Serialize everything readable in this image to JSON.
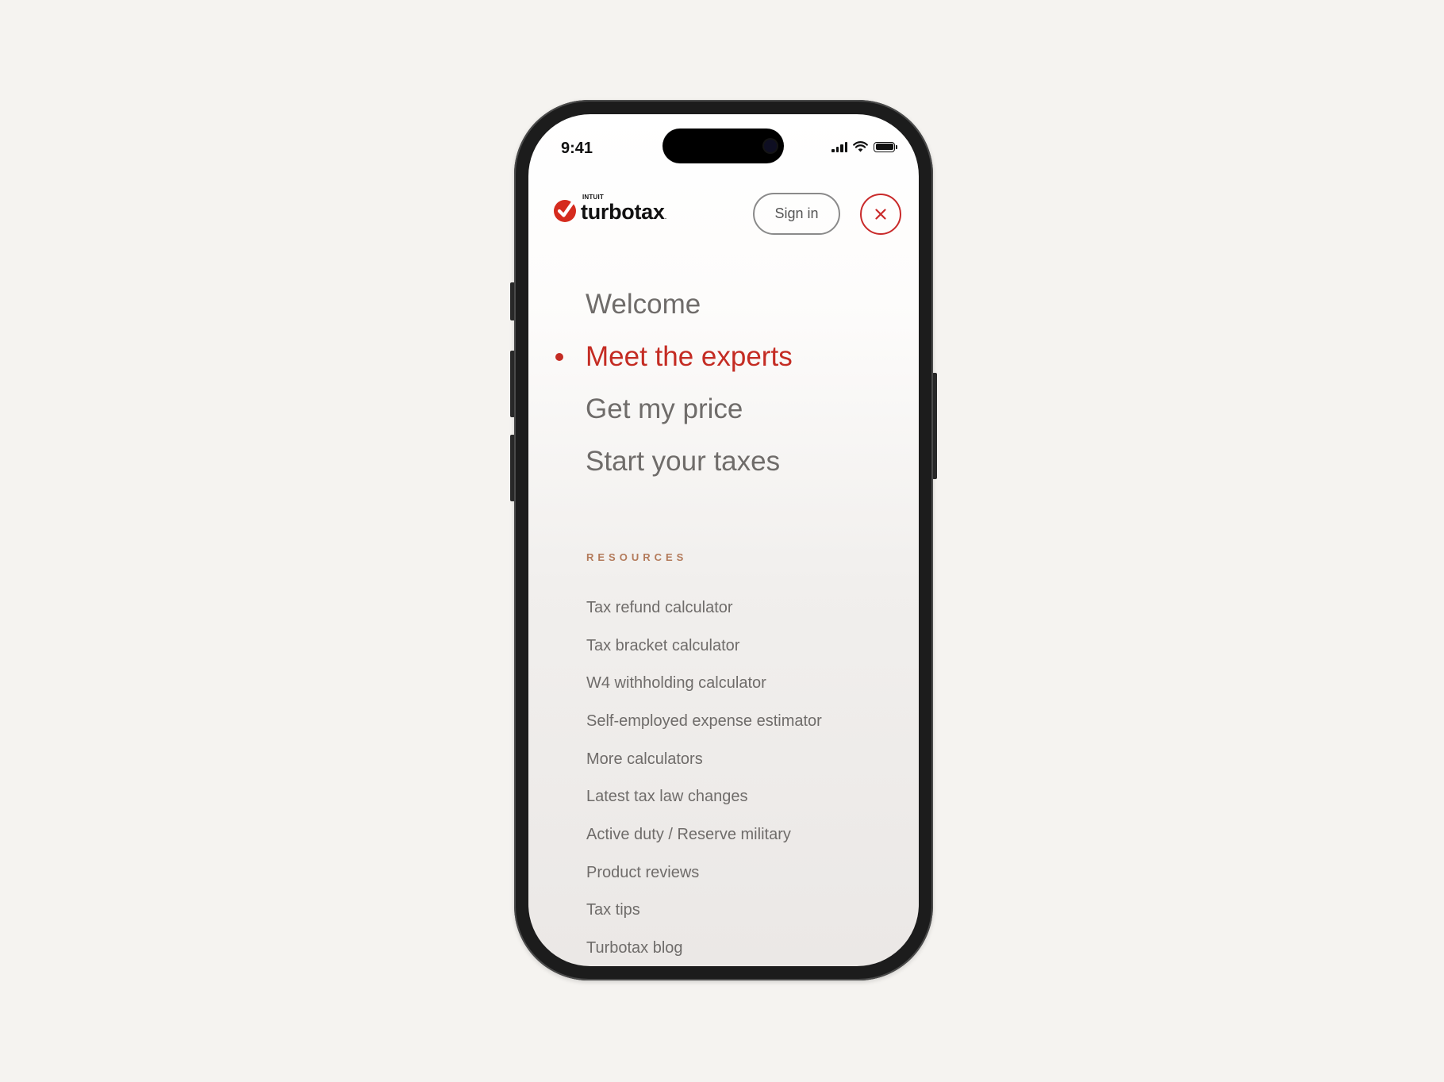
{
  "status_bar": {
    "time": "9:41",
    "icons": [
      "cellular-signal-icon",
      "wifi-icon",
      "battery-icon"
    ]
  },
  "header": {
    "logo_small": "INTUIT",
    "logo_word": "turbotax",
    "signin_label": "Sign in",
    "close_icon": "close-icon"
  },
  "nav": {
    "items": [
      {
        "label": "Welcome",
        "active": false
      },
      {
        "label": "Meet the experts",
        "active": true
      },
      {
        "label": "Get my price",
        "active": false
      },
      {
        "label": "Start your taxes",
        "active": false
      }
    ]
  },
  "resources": {
    "heading": "RESOURCES",
    "items": [
      "Tax refund calculator",
      "Tax bracket calculator",
      "W4 withholding calculator",
      "Self-employed expense estimator",
      "More calculators",
      "Latest tax law changes",
      "Active duty / Reserve military",
      "Product reviews",
      "Tax tips",
      "Turbotax blog"
    ]
  },
  "colors": {
    "background": "#f5f3f0",
    "accent": "#c42c23",
    "text_muted": "#6f6c6a",
    "resources_heading": "#b37a5a"
  }
}
